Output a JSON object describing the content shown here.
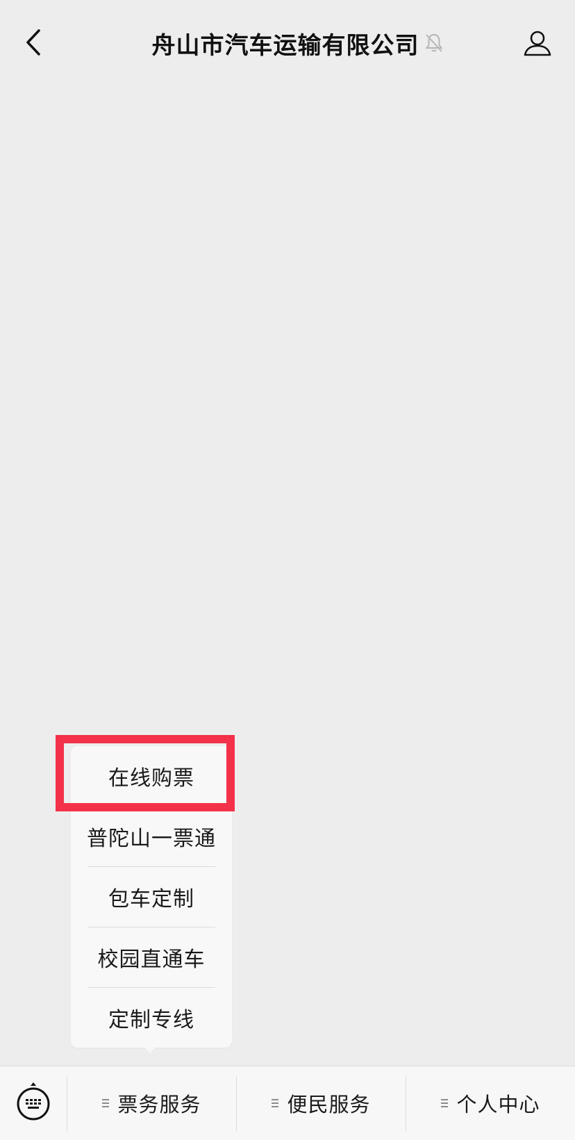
{
  "header": {
    "title": "舟山市汽车运输有限公司",
    "back_icon": "chevron-left-icon",
    "mute_icon": "bell-muted-icon",
    "profile_icon": "person-icon"
  },
  "submenu": {
    "items": [
      {
        "label": "在线购票"
      },
      {
        "label": "普陀山一票通"
      },
      {
        "label": "包车定制"
      },
      {
        "label": "校园直通车"
      },
      {
        "label": "定制专线"
      }
    ],
    "highlight_color": "#f33148"
  },
  "bottom_bar": {
    "keyboard_icon": "keyboard-icon",
    "menus": [
      {
        "label": "票务服务"
      },
      {
        "label": "便民服务"
      },
      {
        "label": "个人中心"
      }
    ]
  }
}
